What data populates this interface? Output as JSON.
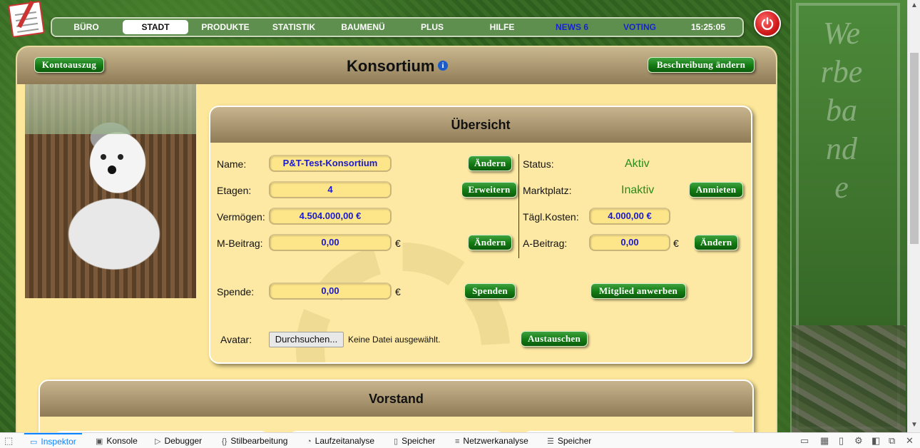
{
  "nav": {
    "items": [
      {
        "label": "BÜRO"
      },
      {
        "label": "STADT"
      },
      {
        "label": "PRODUKTE"
      },
      {
        "label": "STATISTIK"
      },
      {
        "label": "BAUMENÜ"
      },
      {
        "label": "PLUS"
      },
      {
        "label": "HILFE"
      },
      {
        "label": "NEWS 6"
      },
      {
        "label": "VOTING"
      }
    ],
    "clock": "15:25:05"
  },
  "banner": {
    "text": "Werbebande"
  },
  "header": {
    "title": "Konsortium",
    "info_icon": "i",
    "left_button": "Kontoauszug",
    "right_button": "Beschreibung ändern"
  },
  "overview": {
    "title": "Übersicht",
    "name_label": "Name:",
    "name_value": "P&T-Test-Konsortium",
    "name_button": "Ändern",
    "floors_label": "Etagen:",
    "floors_value": "4",
    "floors_button": "Erweitern",
    "assets_label": "Vermögen:",
    "assets_value": "4.504.000,00 €",
    "mfee_label": "M-Beitrag:",
    "mfee_value": "0,00",
    "mfee_unit": "€",
    "mfee_button": "Ändern",
    "status_label": "Status:",
    "status_value": "Aktiv",
    "market_label": "Marktplatz:",
    "market_value": "Inaktiv",
    "market_button": "Anmieten",
    "daily_label": "Tägl.Kosten:",
    "daily_value": "4.000,00 €",
    "afee_label": "A-Beitrag:",
    "afee_value": "0,00",
    "afee_unit": "€",
    "afee_button": "Ändern",
    "donation_label": "Spende:",
    "donation_value": "0,00",
    "donation_unit": "€",
    "donation_button": "Spenden",
    "recruit_button": "Mitglied anwerben",
    "avatar_label": "Avatar:",
    "browse_button": "Durchsuchen...",
    "no_file": "Keine Datei ausgewählt.",
    "replace_button": "Austauschen"
  },
  "vorstand": {
    "title": "Vorstand"
  },
  "devtools": {
    "tabs": [
      {
        "label": "Inspektor"
      },
      {
        "label": "Konsole"
      },
      {
        "label": "Debugger"
      },
      {
        "label": "Stilbearbeitung"
      },
      {
        "label": "Laufzeitanalyse"
      },
      {
        "label": "Speicher"
      },
      {
        "label": "Netzwerkanalyse"
      },
      {
        "label": "Speicher"
      }
    ]
  }
}
